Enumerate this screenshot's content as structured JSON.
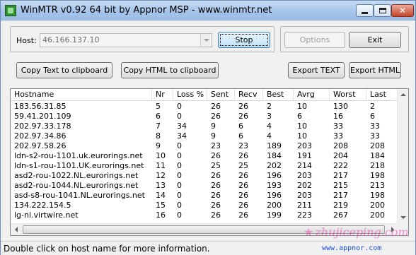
{
  "window": {
    "title": "WinMTR v0.92 64 bit by Appnor MSP - www.winmtr.net"
  },
  "host": {
    "label": "Host:",
    "value": "46.166.137.10"
  },
  "buttons": {
    "stop": "Stop",
    "options": "Options",
    "exit": "Exit",
    "copy_text": "Copy Text to clipboard",
    "copy_html": "Copy HTML to clipboard",
    "export_text": "Export TEXT",
    "export_html": "Export HTML"
  },
  "table": {
    "columns": [
      "Hostname",
      "Nr",
      "Loss %",
      "Sent",
      "Recv",
      "Best",
      "Avrg",
      "Worst",
      "Last"
    ],
    "rows": [
      [
        "183.56.31.85",
        "5",
        "0",
        "26",
        "26",
        "2",
        "10",
        "130",
        "2"
      ],
      [
        "59.41.201.109",
        "6",
        "0",
        "26",
        "26",
        "3",
        "6",
        "16",
        "6"
      ],
      [
        "202.97.33.178",
        "7",
        "34",
        "9",
        "6",
        "4",
        "10",
        "33",
        "33"
      ],
      [
        "202.97.34.86",
        "8",
        "34",
        "9",
        "6",
        "4",
        "10",
        "33",
        "33"
      ],
      [
        "202.97.58.26",
        "9",
        "0",
        "23",
        "23",
        "189",
        "203",
        "208",
        "208"
      ],
      [
        "ldn-s2-rou-1101.uk.eurorings.net",
        "10",
        "0",
        "26",
        "26",
        "184",
        "191",
        "204",
        "184"
      ],
      [
        "ldn-s1-rou-1101.UK.eurorings.net",
        "11",
        "0",
        "25",
        "25",
        "202",
        "214",
        "222",
        "218"
      ],
      [
        "asd2-rou-1022.NL.eurorings.net",
        "12",
        "0",
        "26",
        "26",
        "196",
        "203",
        "217",
        "198"
      ],
      [
        "asd2-rou-1044.NL.eurorings.net",
        "13",
        "0",
        "26",
        "26",
        "193",
        "202",
        "215",
        "213"
      ],
      [
        "asd-s8-rou-1041.NL.eurorings.net",
        "14",
        "0",
        "26",
        "26",
        "196",
        "203",
        "217",
        "198"
      ],
      [
        "134.222.154.5",
        "15",
        "0",
        "26",
        "26",
        "200",
        "211",
        "219",
        "200"
      ],
      [
        "lg-nl.virtwire.net",
        "16",
        "0",
        "26",
        "26",
        "199",
        "223",
        "267",
        "200"
      ]
    ]
  },
  "status": {
    "text": "Double click on host name for more information.",
    "link": "www.appnor.com"
  },
  "watermark": "zhujiceping.com"
}
